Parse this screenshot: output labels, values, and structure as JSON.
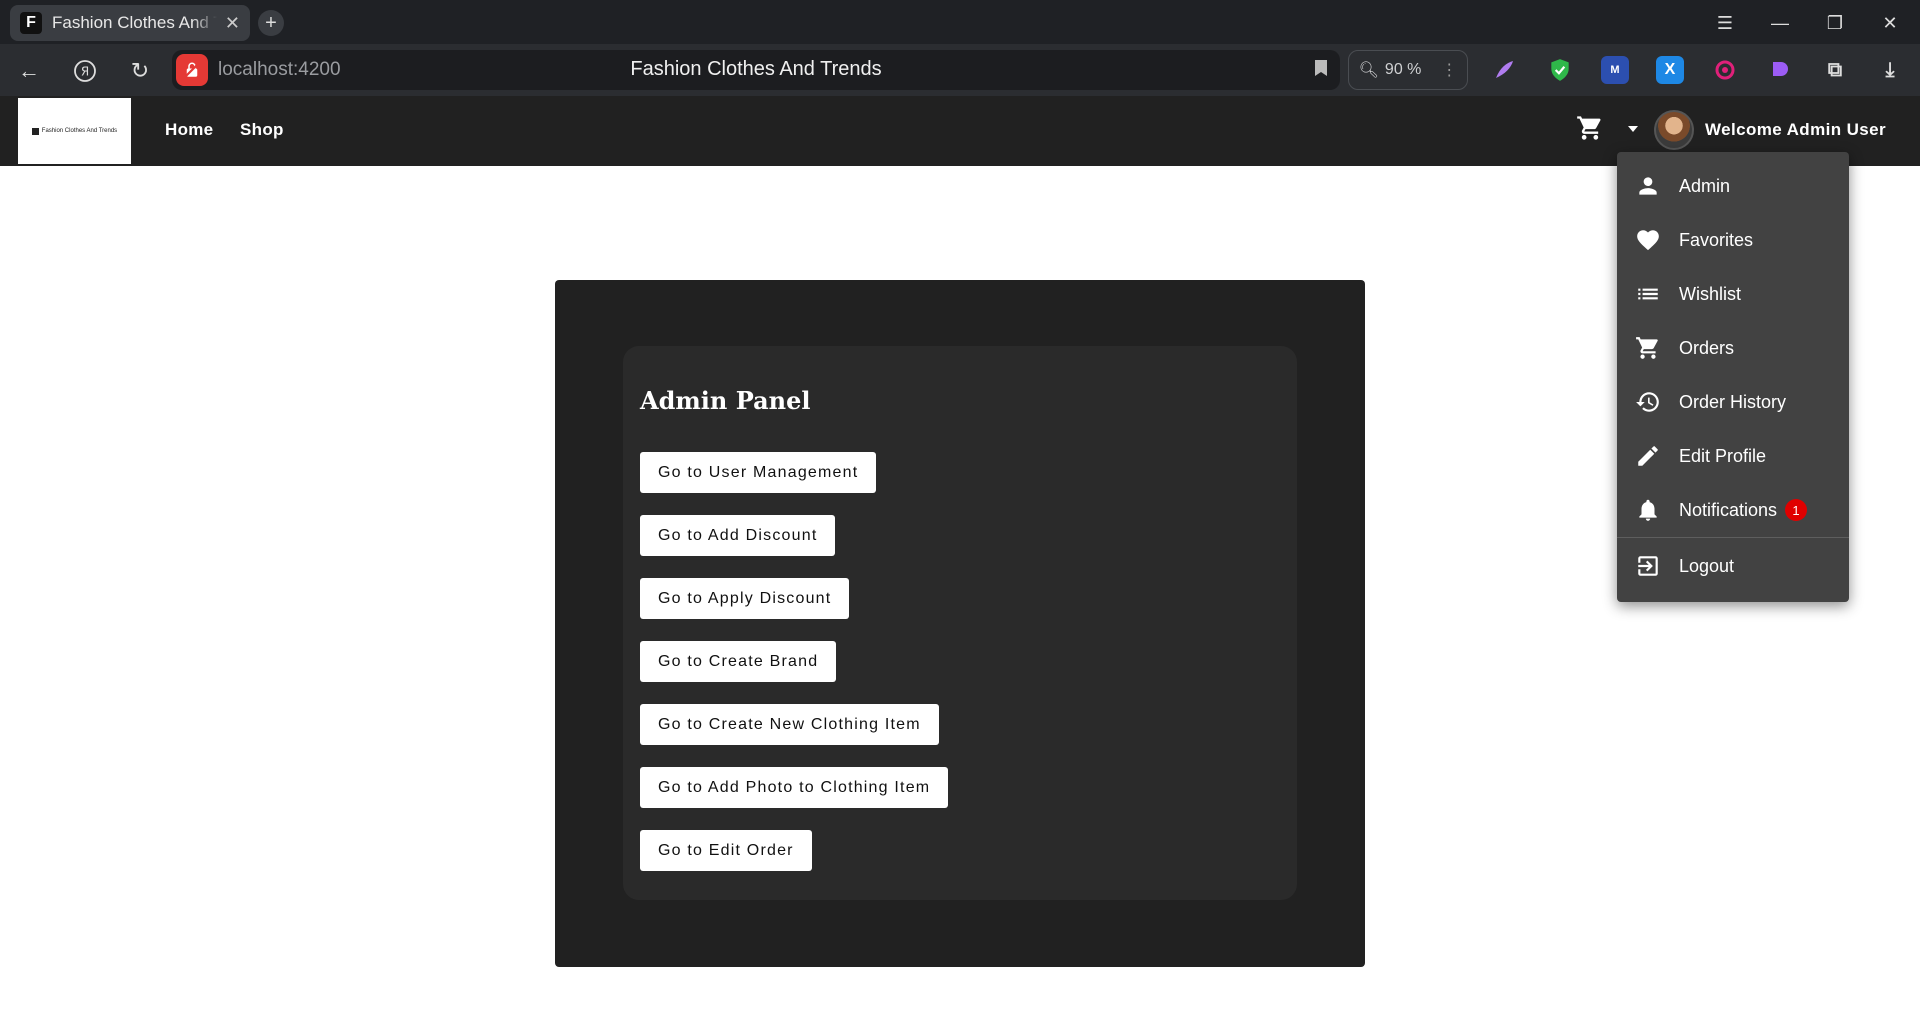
{
  "browser": {
    "tab_title": "Fashion Clothes And Trends",
    "tab_favicon_letter": "F",
    "url": "localhost:4200",
    "page_title": "Fashion Clothes And Trends",
    "zoom": "90 %"
  },
  "header": {
    "logo_text": "Fashion Clothes And Trends",
    "nav": [
      {
        "label": "Home"
      },
      {
        "label": "Shop"
      }
    ],
    "welcome": "Welcome Admin User"
  },
  "admin_panel": {
    "title": "Admin Panel",
    "buttons": [
      {
        "label": "Go to User Management"
      },
      {
        "label": "Go to Add Discount"
      },
      {
        "label": "Go to Apply Discount"
      },
      {
        "label": "Go to Create Brand"
      },
      {
        "label": "Go to Create New Clothing Item"
      },
      {
        "label": "Go to Add Photo to Clothing Item"
      },
      {
        "label": "Go to Edit Order"
      }
    ]
  },
  "user_menu": {
    "items": [
      {
        "label": "Admin",
        "icon": "person-icon"
      },
      {
        "label": "Favorites",
        "icon": "heart-icon"
      },
      {
        "label": "Wishlist",
        "icon": "list-icon"
      },
      {
        "label": "Orders",
        "icon": "cart-icon"
      },
      {
        "label": "Order History",
        "icon": "history-icon"
      },
      {
        "label": "Edit Profile",
        "icon": "pencil-icon"
      },
      {
        "label": "Notifications",
        "icon": "bell-icon",
        "badge": "1"
      },
      {
        "label": "Logout",
        "icon": "logout-icon"
      }
    ]
  },
  "colors": {
    "header_bg": "#212121",
    "panel_bg": "#212121",
    "card_bg": "#2a2a2a",
    "menu_bg": "#424242",
    "badge": "#e00000"
  }
}
